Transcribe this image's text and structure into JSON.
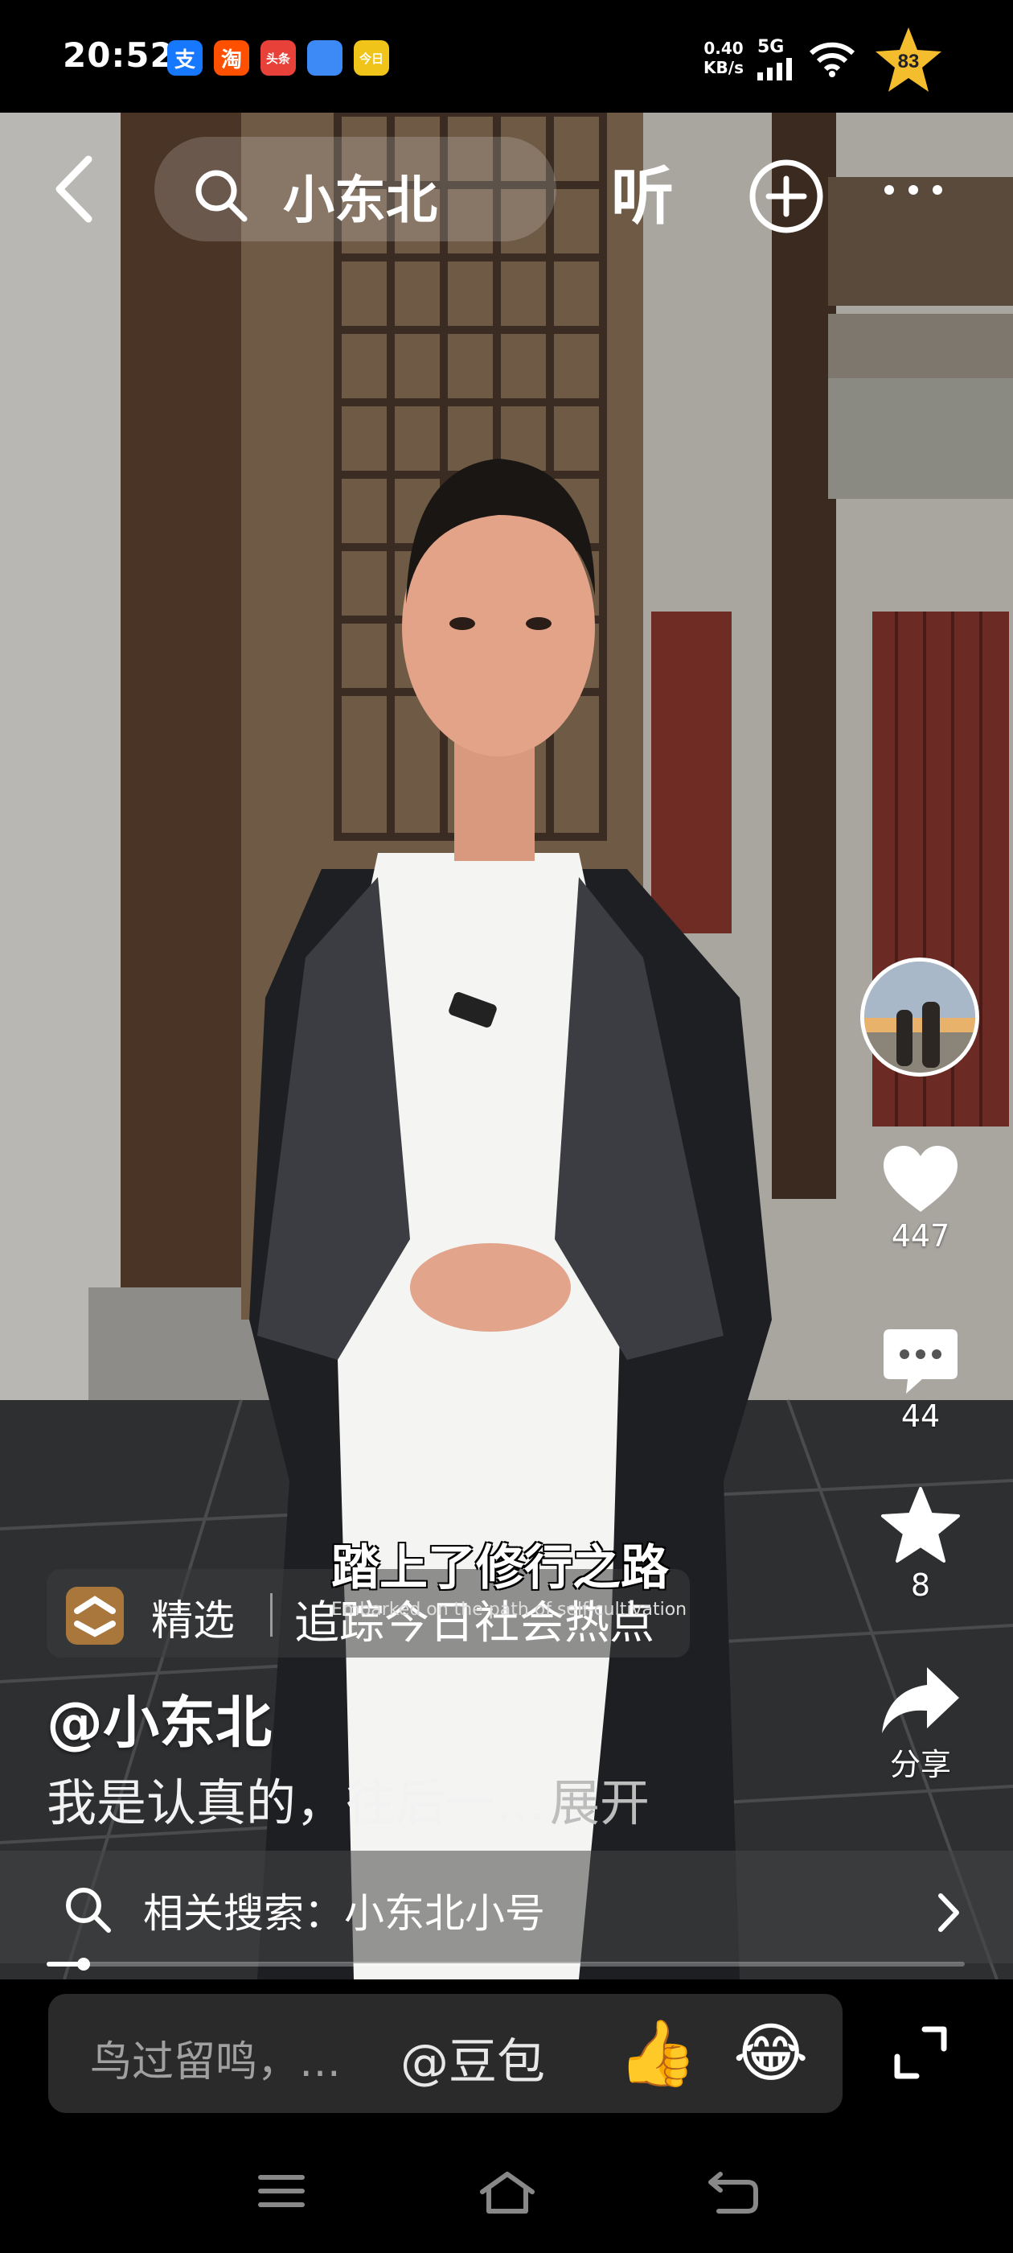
{
  "status_bar": {
    "time": "20:52",
    "apps": [
      {
        "icon": "alipay-icon",
        "glyph": "支",
        "color": "#1677ff"
      },
      {
        "icon": "taobao-icon",
        "glyph": "淘",
        "color": "#ff5000"
      },
      {
        "icon": "toutiao-icon",
        "glyph": "头条",
        "color": "#e8413a"
      },
      {
        "icon": "app-blue-icon",
        "glyph": "",
        "color": "#3d8af7"
      },
      {
        "icon": "app-yellow-icon",
        "glyph": "今日",
        "color": "#f0c419"
      }
    ],
    "speed_value": "0.40",
    "speed_unit": "KB/s",
    "network": "5G",
    "badge_count": "83"
  },
  "top_bar": {
    "search_text": "小东北",
    "listen_label": "听"
  },
  "actions": {
    "like_count": "447",
    "comment_count": "44",
    "favorite_count": "8",
    "share_label": "分享"
  },
  "subtitle": {
    "text": "踏上了修行之路",
    "small_text": "Embarked on the path of self-cultivation"
  },
  "featured": {
    "label": "精选",
    "topic": "追踪今日社会热点"
  },
  "author": "@小东北",
  "caption": {
    "text": "我是认真的，往后一…",
    "expand": "展开"
  },
  "related_search": {
    "text": "相关搜索：小东北小号"
  },
  "progress": {
    "fraction": 0.04
  },
  "comment_bar": {
    "placeholder": "鸟过留鸣，…",
    "mention": "@豆包",
    "emoji_1": "👍",
    "emoji_2": "😂"
  }
}
